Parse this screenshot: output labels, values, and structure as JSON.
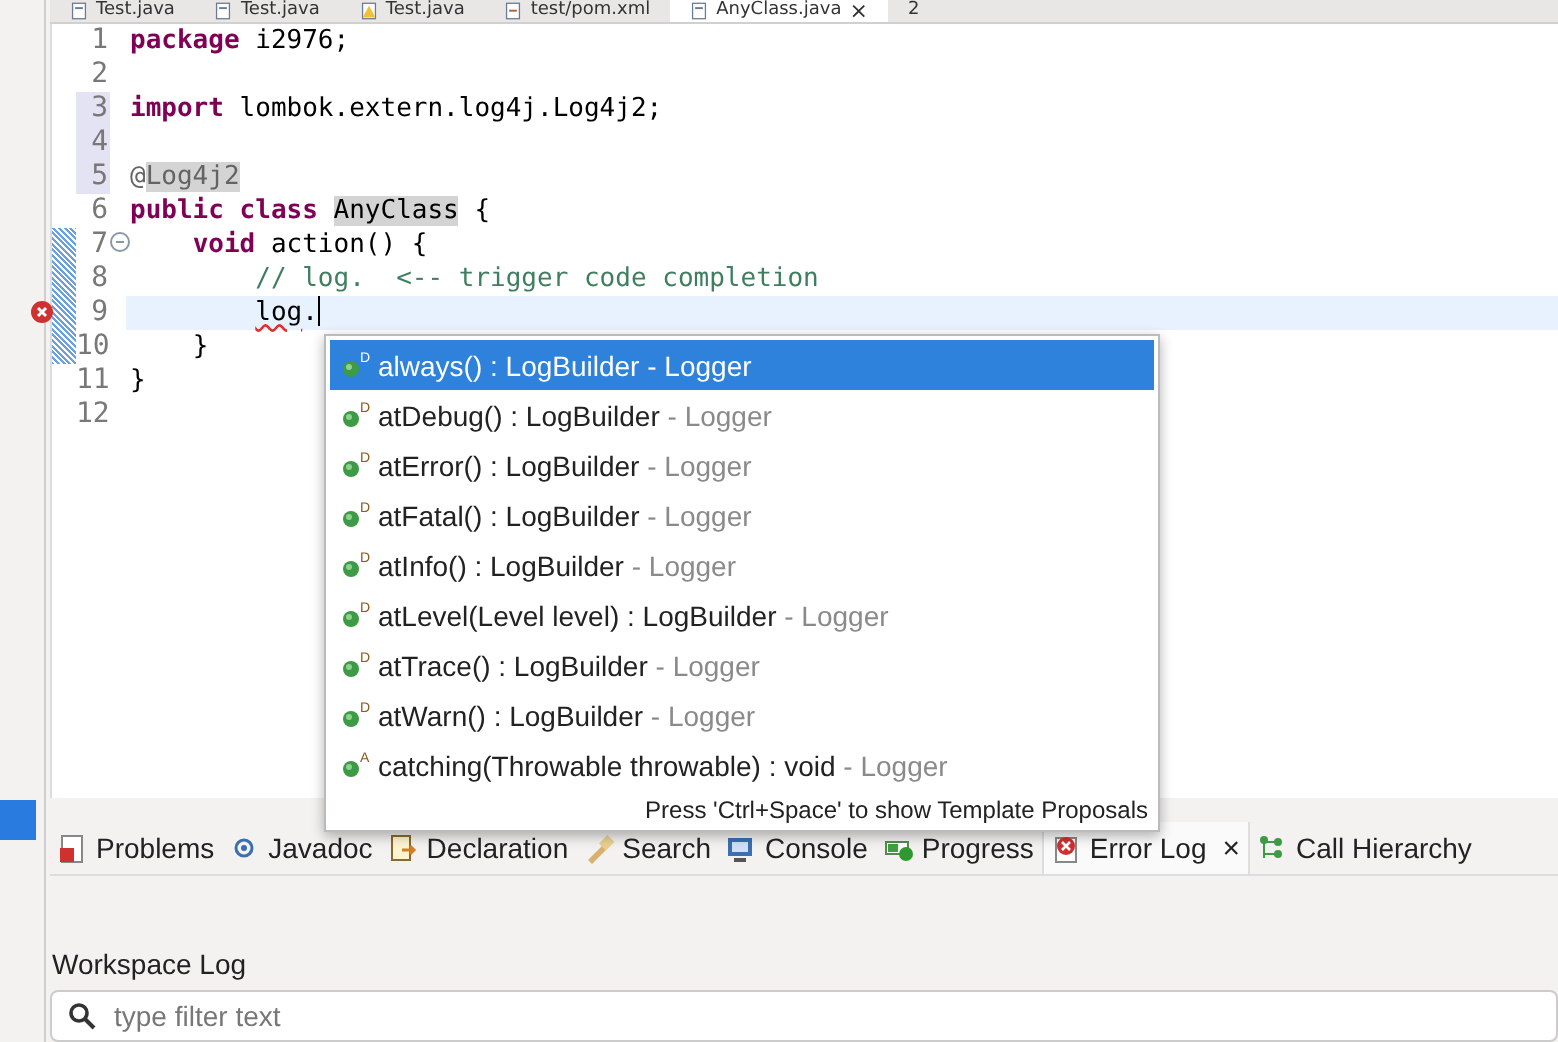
{
  "editor_tabs": [
    {
      "label": "Test.java",
      "selected": false
    },
    {
      "label": "Test.java",
      "selected": false
    },
    {
      "label": "Test.java",
      "selected": false
    },
    {
      "label": "test/pom.xml",
      "selected": false
    },
    {
      "label": "AnyClass.java",
      "selected": true,
      "close": "×"
    },
    {
      "label": "2",
      "selected": false
    }
  ],
  "editor": {
    "lines": [
      {
        "number": "1",
        "segments": [
          {
            "text": "package",
            "kind": "keyword"
          },
          {
            "text": " i2976;",
            "kind": "plain"
          }
        ]
      },
      {
        "number": "2"
      },
      {
        "number": "3",
        "shaded": true,
        "segments": [
          {
            "text": "import",
            "kind": "keyword"
          },
          {
            "text": " lombok.extern.log4j.Log4j2;",
            "kind": "plain"
          }
        ]
      },
      {
        "number": "4",
        "shaded": true
      },
      {
        "number": "5",
        "shaded": true,
        "segments": [
          {
            "text": "@",
            "kind": "annotation"
          },
          {
            "text": "Log4j2",
            "kind": "occurrence-annotation"
          }
        ]
      },
      {
        "number": "6",
        "segments": [
          {
            "text": "public",
            "kind": "keyword"
          },
          {
            "text": " class",
            "kind": "keyword"
          },
          {
            "text": " AnyClass",
            "kind": "occurrence"
          },
          {
            "text": " {",
            "kind": "plain"
          }
        ]
      },
      {
        "number": "7",
        "changed": true,
        "expanded": true,
        "segments": [
          {
            "text": "    void",
            "kind": "keyword"
          },
          {
            "text": " action() {",
            "kind": "plain"
          }
        ]
      },
      {
        "number": "8",
        "changed": true,
        "segments": [
          {
            "text": "        // log.  <-- trigger code completion",
            "kind": "comment"
          }
        ]
      },
      {
        "number": "9",
        "changed": true,
        "error": true,
        "current": true,
        "segments": [
          {
            "text": "        log",
            "kind": "error"
          },
          {
            "text": ".",
            "kind": "plain"
          }
        ]
      },
      {
        "number": "10",
        "changed": true,
        "segments": [
          {
            "text": "    }",
            "kind": "plain"
          }
        ]
      },
      {
        "number": "11",
        "segments": [
          {
            "text": "}",
            "kind": "plain"
          }
        ]
      },
      {
        "number": "12"
      }
    ]
  },
  "completion": {
    "proposals": [
      {
        "badge": "D",
        "signature": "always() : LogBuilder",
        "declaring": " - Logger",
        "selected": true
      },
      {
        "badge": "D",
        "signature": "atDebug() : LogBuilder",
        "declaring": " - Logger",
        "selected": false
      },
      {
        "badge": "D",
        "signature": "atError() : LogBuilder",
        "declaring": " - Logger",
        "selected": false
      },
      {
        "badge": "D",
        "signature": "atFatal() : LogBuilder",
        "declaring": " - Logger",
        "selected": false
      },
      {
        "badge": "D",
        "signature": "atInfo() : LogBuilder",
        "declaring": " - Logger",
        "selected": false
      },
      {
        "badge": "D",
        "signature": "atLevel(Level level) : LogBuilder",
        "declaring": " - Logger",
        "selected": false
      },
      {
        "badge": "D",
        "signature": "atTrace() : LogBuilder",
        "declaring": " - Logger",
        "selected": false
      },
      {
        "badge": "D",
        "signature": "atWarn() : LogBuilder",
        "declaring": " - Logger",
        "selected": false
      },
      {
        "badge": "A",
        "signature": "catching(Throwable throwable) : void",
        "declaring": " - Logger",
        "selected": false
      }
    ],
    "hint": "Press 'Ctrl+Space' to show Template Proposals"
  },
  "panel_tabs": [
    {
      "label": "Problems",
      "selected": false
    },
    {
      "label": "Javadoc",
      "selected": false
    },
    {
      "label": "Declaration",
      "selected": false
    },
    {
      "label": "Search",
      "selected": false
    },
    {
      "label": "Console",
      "selected": false
    },
    {
      "label": "Progress",
      "selected": false
    },
    {
      "label": "Error Log",
      "selected": true,
      "close": "×"
    },
    {
      "label": "Call Hierarchy",
      "selected": false
    }
  ],
  "panel": {
    "title": "Workspace Log",
    "filter": {
      "placeholder": "type filter text"
    }
  }
}
